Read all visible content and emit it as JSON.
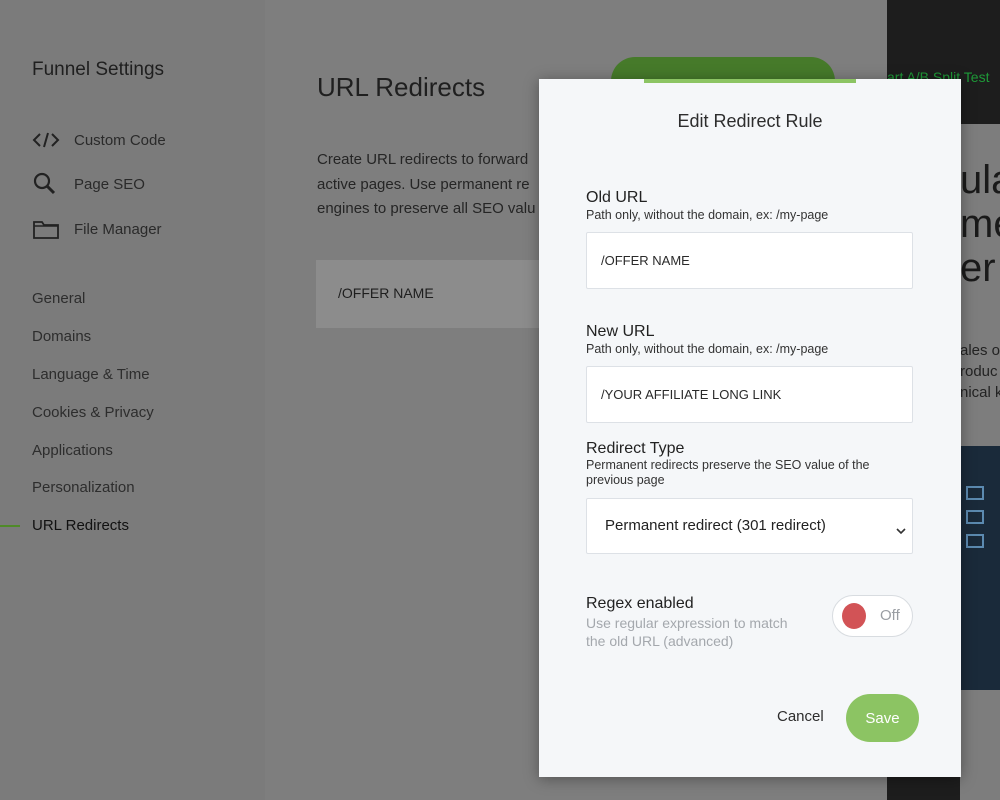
{
  "sidebar": {
    "title": "Funnel Settings",
    "tools": [
      {
        "label": "Custom Code",
        "icon": "code-icon"
      },
      {
        "label": "Page SEO",
        "icon": "search-icon"
      },
      {
        "label": "File Manager",
        "icon": "folder-icon"
      }
    ],
    "nav": [
      {
        "label": "General"
      },
      {
        "label": "Domains"
      },
      {
        "label": "Language & Time"
      },
      {
        "label": "Cookies & Privacy"
      },
      {
        "label": "Applications"
      },
      {
        "label": "Personalization"
      },
      {
        "label": "URL Redirects",
        "active": true
      }
    ]
  },
  "main": {
    "title": "URL Redirects",
    "description_lines": [
      "Create URL redirects to forward",
      "active pages. Use permanent re",
      "engines to preserve all SEO valu"
    ],
    "redirect_row_label": "/OFFER NAME"
  },
  "right_panel": {
    "ab_test_label": "art A/B Split Test",
    "headline_lines": [
      "ula",
      "me",
      "er D"
    ],
    "body_lines": [
      "ales o",
      "roduc",
      "nical k"
    ]
  },
  "modal": {
    "title": "Edit Redirect Rule",
    "old_url": {
      "label": "Old URL",
      "hint": "Path only, without the domain, ex: /my-page",
      "value": "/OFFER NAME"
    },
    "new_url": {
      "label": "New URL",
      "hint": "Path only, without the domain, ex: /my-page",
      "value": "/YOUR AFFILIATE LONG LINK"
    },
    "redirect_type": {
      "label": "Redirect Type",
      "hint": "Permanent redirects preserve the SEO value of the previous page",
      "selected": "Permanent redirect (301 redirect)"
    },
    "regex": {
      "label": "Regex enabled",
      "hint": "Use regular expression to match the old URL (advanced)",
      "state": "Off"
    },
    "cancel_label": "Cancel",
    "save_label": "Save"
  },
  "colors": {
    "accent": "#8cc463",
    "toggle_off": "#d25356",
    "ab_test_text": "#1e9a38"
  }
}
